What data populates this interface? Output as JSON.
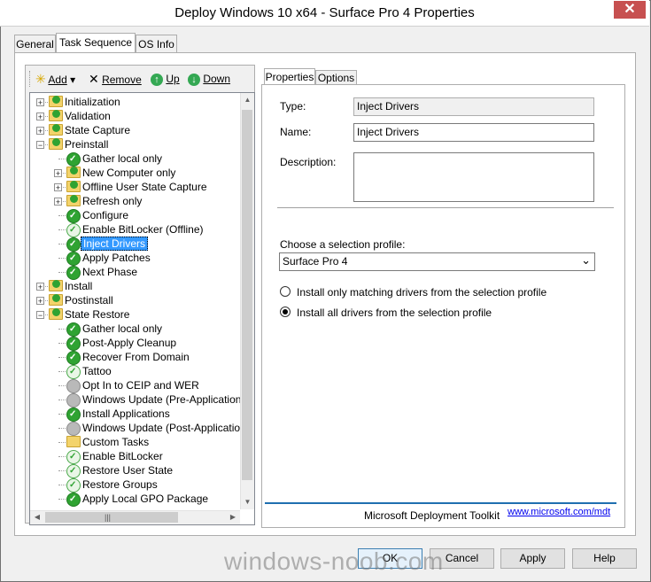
{
  "window": {
    "title": "Deploy Windows 10 x64 - Surface Pro 4 Properties",
    "close_symbol": "✕"
  },
  "tabs": {
    "items": [
      "General",
      "Task Sequence",
      "OS Info"
    ],
    "active": "Task Sequence"
  },
  "toolbar": {
    "add": "Add",
    "add_arrow": "▾",
    "remove": "Remove",
    "up": "Up",
    "down": "Down",
    "add_icon": "✳",
    "remove_icon": "✕",
    "up_icon": "↑",
    "down_icon": "↓"
  },
  "tree": {
    "items": [
      {
        "label": "Initialization",
        "level": 0,
        "expander": "+",
        "icon": "folderchk"
      },
      {
        "label": "Validation",
        "level": 0,
        "expander": "+",
        "icon": "folderchk"
      },
      {
        "label": "State Capture",
        "level": 0,
        "expander": "+",
        "icon": "folderchk"
      },
      {
        "label": "Preinstall",
        "level": 0,
        "expander": "-",
        "icon": "folderchk"
      },
      {
        "label": "Gather local only",
        "level": 1,
        "expander": "",
        "icon": "check"
      },
      {
        "label": "New Computer only",
        "level": 1,
        "expander": "+",
        "icon": "folderchk"
      },
      {
        "label": "Offline User State Capture",
        "level": 1,
        "expander": "+",
        "icon": "folderchk"
      },
      {
        "label": "Refresh only",
        "level": 1,
        "expander": "+",
        "icon": "folderchk"
      },
      {
        "label": "Configure",
        "level": 1,
        "expander": "",
        "icon": "check"
      },
      {
        "label": "Enable BitLocker (Offline)",
        "level": 1,
        "expander": "",
        "icon": "checklight"
      },
      {
        "label": "Inject Drivers",
        "level": 1,
        "expander": "",
        "icon": "check",
        "selected": true
      },
      {
        "label": "Apply Patches",
        "level": 1,
        "expander": "",
        "icon": "check"
      },
      {
        "label": "Next Phase",
        "level": 1,
        "expander": "",
        "icon": "check"
      },
      {
        "label": "Install",
        "level": 0,
        "expander": "+",
        "icon": "folderchk"
      },
      {
        "label": "Postinstall",
        "level": 0,
        "expander": "+",
        "icon": "folderchk"
      },
      {
        "label": "State Restore",
        "level": 0,
        "expander": "-",
        "icon": "folderchk"
      },
      {
        "label": "Gather local only",
        "level": 1,
        "expander": "",
        "icon": "check"
      },
      {
        "label": "Post-Apply Cleanup",
        "level": 1,
        "expander": "",
        "icon": "check"
      },
      {
        "label": "Recover From Domain",
        "level": 1,
        "expander": "",
        "icon": "check"
      },
      {
        "label": "Tattoo",
        "level": 1,
        "expander": "",
        "icon": "checklight"
      },
      {
        "label": "Opt In to CEIP and WER",
        "level": 1,
        "expander": "",
        "icon": "disabled"
      },
      {
        "label": "Windows Update (Pre-Application Inst",
        "level": 1,
        "expander": "",
        "icon": "disabled"
      },
      {
        "label": "Install Applications",
        "level": 1,
        "expander": "",
        "icon": "check"
      },
      {
        "label": "Windows Update (Post-Application Ins",
        "level": 1,
        "expander": "",
        "icon": "disabled"
      },
      {
        "label": "Custom Tasks",
        "level": 1,
        "expander": "",
        "icon": "folder"
      },
      {
        "label": "Enable BitLocker",
        "level": 1,
        "expander": "",
        "icon": "checklight"
      },
      {
        "label": "Restore User State",
        "level": 1,
        "expander": "",
        "icon": "checklight"
      },
      {
        "label": "Restore Groups",
        "level": 1,
        "expander": "",
        "icon": "checklight"
      },
      {
        "label": "Apply Local GPO Package",
        "level": 1,
        "expander": "",
        "icon": "check"
      }
    ]
  },
  "scrollbars": {
    "up": "▲",
    "down": "▼",
    "left": "◀",
    "right": "▶",
    "grip": "|||"
  },
  "subtabs": {
    "items": [
      "Properties",
      "Options"
    ],
    "active": "Properties"
  },
  "properties": {
    "type_label": "Type:",
    "type_value": "Inject Drivers",
    "name_label": "Name:",
    "name_value": "Inject Drivers",
    "description_label": "Description:",
    "description_value": "",
    "profile_label": "Choose a selection profile:",
    "profile_value": "Surface Pro 4",
    "profile_arrow": "⌄",
    "radio_options": [
      {
        "label": "Install only matching drivers from the selection profile",
        "checked": false
      },
      {
        "label": "Install all drivers from the selection profile",
        "checked": true
      }
    ]
  },
  "footer": {
    "toolkit": "Microsoft Deployment Toolkit",
    "link": "www.microsoft.com/mdt"
  },
  "buttons": {
    "ok": "OK",
    "cancel": "Cancel",
    "apply": "Apply",
    "help": "Help"
  },
  "watermark": "windows-noob.com"
}
